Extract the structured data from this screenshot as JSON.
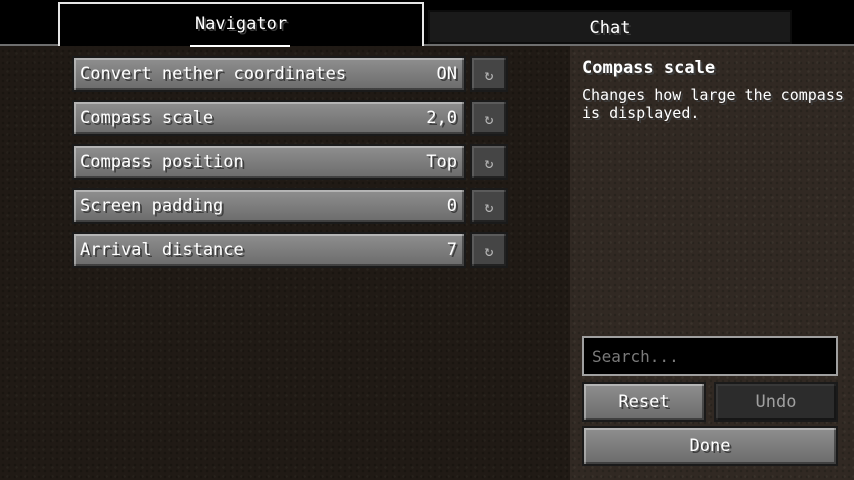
{
  "tabs": [
    {
      "label": "Navigator",
      "active": true
    },
    {
      "label": "Chat",
      "active": false
    }
  ],
  "options": [
    {
      "label": "Convert nether coordinates",
      "value": "ON"
    },
    {
      "label": "Compass scale",
      "value": "2,0"
    },
    {
      "label": "Compass position",
      "value": "Top"
    },
    {
      "label": "Screen padding",
      "value": "0"
    },
    {
      "label": "Arrival distance",
      "value": "7"
    }
  ],
  "reset_icon": "↻",
  "description": {
    "title": "Compass scale",
    "text": "Changes how large the compass is displayed."
  },
  "search": {
    "placeholder": "Search...",
    "value": ""
  },
  "buttons": {
    "reset": "Reset",
    "undo": "Undo",
    "done": "Done"
  },
  "icons": {
    "reset_option": "refresh-icon"
  }
}
